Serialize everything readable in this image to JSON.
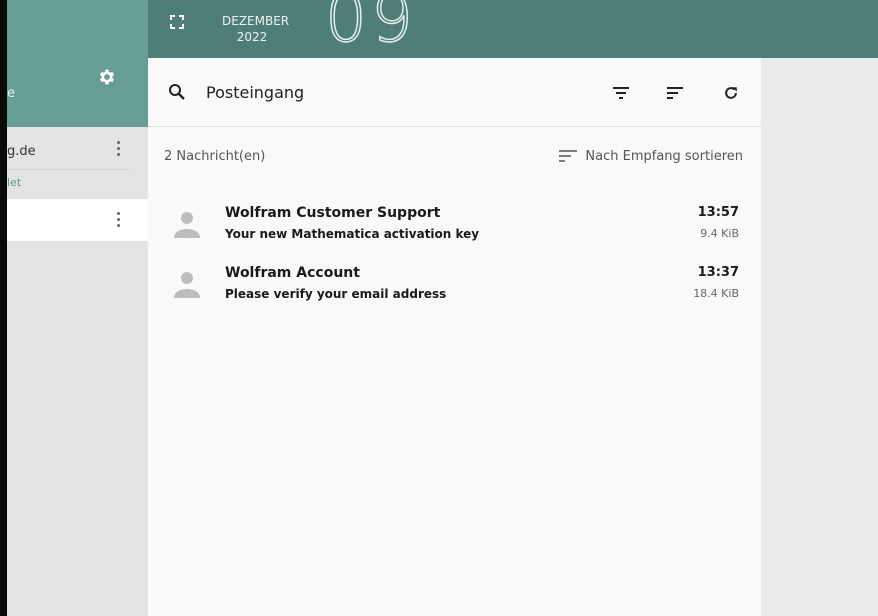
{
  "header": {
    "month": "DEZEMBER",
    "year": "2022",
    "day": "09"
  },
  "sidebar": {
    "cut_title": "e",
    "account_label": "g.de",
    "account_sub": "let"
  },
  "toolbar": {
    "folder": "Posteingang"
  },
  "list": {
    "count": "2 Nachricht(en)",
    "sort_label": "Nach Empfang sortieren",
    "messages": [
      {
        "from": "Wolfram Customer Support",
        "subject": "Your new Mathematica activation key",
        "time": "13:57",
        "size": "9.4 KiB"
      },
      {
        "from": "Wolfram Account",
        "subject": "Please verify your email address",
        "time": "13:37",
        "size": "18.4 KiB"
      }
    ]
  },
  "colors": {
    "header": "#4f7d77",
    "sidebar_header": "#679d95",
    "accent": "#5e9b93"
  },
  "icons": [
    "gear-icon",
    "expand-icon",
    "search-icon",
    "filter-icon",
    "sort-icon",
    "refresh-icon",
    "more-vertical-icon",
    "person-icon"
  ]
}
